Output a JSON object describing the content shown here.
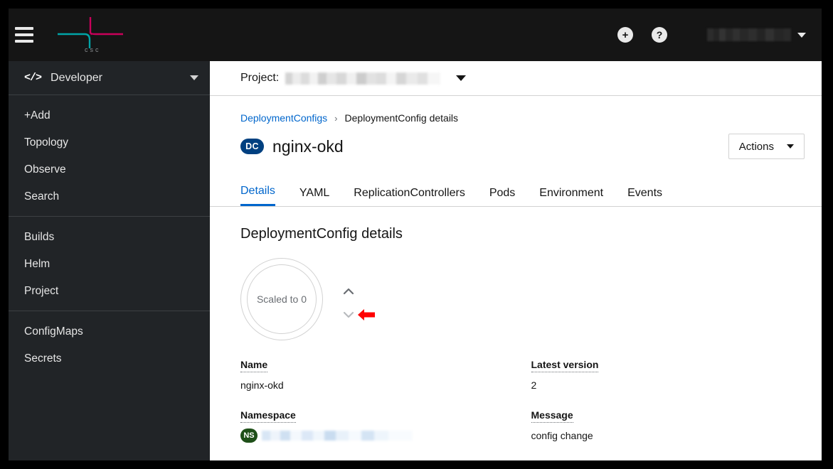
{
  "masthead": {
    "hamburger_icon": "hamburger-menu-icon",
    "logo": {
      "name": "csc-logo",
      "wordmark": "csc"
    },
    "add_icon_label": "+",
    "help_icon_label": "?",
    "user_name_redacted": "",
    "colors": {
      "background": "#151515",
      "logo_teal": "#00a4a7",
      "logo_magenta": "#c9005a"
    }
  },
  "sidebar": {
    "perspective": {
      "icon": "code-icon",
      "icon_glyph": "</>",
      "label": "Developer"
    },
    "groups": [
      {
        "items": [
          {
            "label": "+Add"
          },
          {
            "label": "Topology"
          },
          {
            "label": "Observe"
          },
          {
            "label": "Search"
          }
        ]
      },
      {
        "items": [
          {
            "label": "Builds"
          },
          {
            "label": "Helm"
          },
          {
            "label": "Project"
          }
        ]
      },
      {
        "items": [
          {
            "label": "ConfigMaps"
          },
          {
            "label": "Secrets"
          }
        ]
      }
    ]
  },
  "project_bar": {
    "label": "Project:",
    "selected_project_redacted": ""
  },
  "breadcrumb": {
    "parent": "DeploymentConfigs",
    "separator": "›",
    "current": "DeploymentConfig details"
  },
  "page": {
    "badge": "DC",
    "title": "nginx-okd",
    "actions_label": "Actions"
  },
  "tabs": [
    {
      "label": "Details",
      "active": true
    },
    {
      "label": "YAML",
      "active": false
    },
    {
      "label": "ReplicationControllers",
      "active": false
    },
    {
      "label": "Pods",
      "active": false
    },
    {
      "label": "Environment",
      "active": false
    },
    {
      "label": "Events",
      "active": false
    }
  ],
  "details": {
    "section_title": "DeploymentConfig details",
    "scale": {
      "status_text": "Scaled to 0",
      "replicas": 0,
      "scale_up_icon": "chevron-up-icon",
      "scale_down_icon": "chevron-down-icon",
      "annotation": {
        "icon": "red-arrow-left-icon",
        "color": "#ff0000",
        "points_at": "scale-down-chevron"
      }
    },
    "fields_left": [
      {
        "label": "Name",
        "value": "nginx-okd"
      },
      {
        "label": "Namespace",
        "value_redacted": "",
        "badge": "NS"
      }
    ],
    "fields_right": [
      {
        "label": "Latest version",
        "value": "2"
      },
      {
        "label": "Message",
        "value": "config change"
      }
    ]
  },
  "colors": {
    "accent_blue": "#0066cc",
    "badge_dc": "#004080",
    "badge_ns": "#1e4f18",
    "sidebar_bg": "#212427",
    "masthead_bg": "#151515"
  }
}
